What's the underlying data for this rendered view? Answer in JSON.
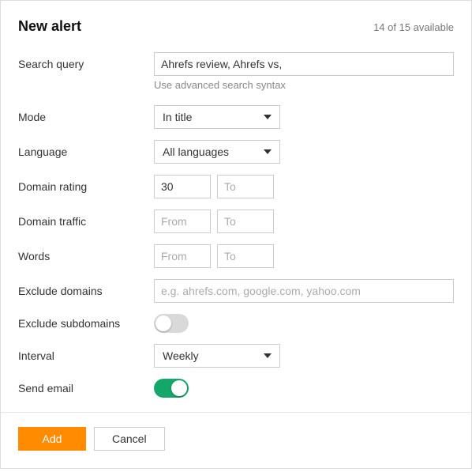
{
  "header": {
    "title": "New alert",
    "availability": "14 of 15 available"
  },
  "labels": {
    "search_query": "Search query",
    "mode": "Mode",
    "language": "Language",
    "domain_rating": "Domain rating",
    "domain_traffic": "Domain traffic",
    "words": "Words",
    "exclude_domains": "Exclude domains",
    "exclude_subdomains": "Exclude subdomains",
    "interval": "Interval",
    "send_email": "Send email"
  },
  "fields": {
    "search_query_value": "Ahrefs review, Ahrefs vs,",
    "search_query_hint": "Use advanced search syntax",
    "mode_value": "In title",
    "language_value": "All languages",
    "domain_rating_from": "30",
    "from_placeholder": "From",
    "to_placeholder": "To",
    "exclude_domains_placeholder": "e.g. ahrefs.com, google.com, yahoo.com",
    "interval_value": "Weekly"
  },
  "buttons": {
    "add": "Add",
    "cancel": "Cancel"
  }
}
